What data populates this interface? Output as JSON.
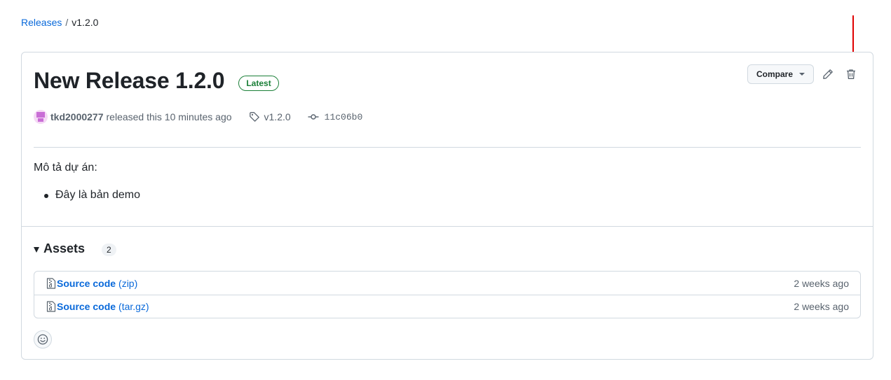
{
  "breadcrumb": {
    "parent": "Releases",
    "separator": "/",
    "current": "v1.2.0"
  },
  "release": {
    "title": "New Release 1.2.0",
    "badge": "Latest",
    "author": "tkd2000277",
    "released_text": "released this 10 minutes ago",
    "tag": "v1.2.0",
    "commit": "11c06b0",
    "description": "Mô tả dự án:",
    "bullets": [
      "Đây là bản demo"
    ]
  },
  "actions": {
    "compare_label": "Compare",
    "edit_icon": "pencil-icon",
    "delete_icon": "trash-icon"
  },
  "assets": {
    "title": "Assets",
    "count": "2",
    "items": [
      {
        "name": "Source code",
        "ext": "(zip)",
        "time": "2 weeks ago",
        "icon": "file-zip-icon"
      },
      {
        "name": "Source code",
        "ext": "(tar.gz)",
        "time": "2 weeks ago",
        "icon": "file-zip-icon"
      }
    ]
  },
  "icons": {
    "tag": "tag-icon",
    "commit": "git-commit-icon",
    "reaction": "smiley-icon",
    "annotation": "red-arrow-annotation"
  },
  "colors": {
    "link": "#0969da",
    "latest_badge": "#1a7f37",
    "border": "#d1d9e0",
    "annotation_arrow": "#e00000"
  }
}
